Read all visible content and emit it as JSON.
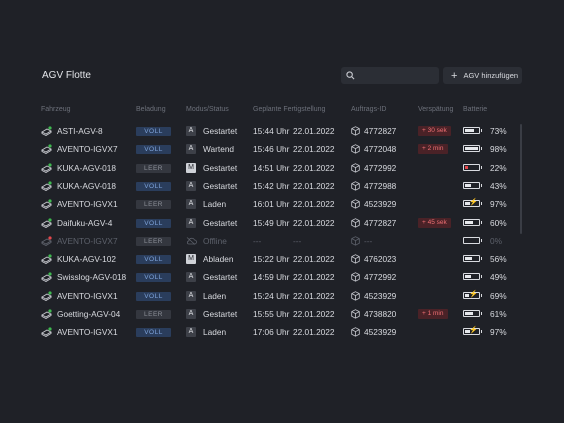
{
  "header": {
    "title": "AGV Flotte",
    "add_button_label": "AGV hinzufügen"
  },
  "search": {
    "placeholder": ""
  },
  "columns": {
    "vehicle": "Fahrzeug",
    "load": "Beladung",
    "mode": "Modus/Status",
    "planned": "Geplante Fertigstellung",
    "order": "Auftrags-ID",
    "delay": "Verspätung",
    "battery": "Batterie"
  },
  "colors": {
    "background": "#1f2127",
    "full_badge": "#2a3d5c",
    "delay_badge": "#4a2227",
    "battery_low": "#e5484d"
  },
  "rows": [
    {
      "vehicle": "ASTI-AGV-8",
      "load": "VOLL",
      "load_state": "full",
      "mode_letter": "A",
      "status": "Gestartet",
      "time": "15:44 Uhr",
      "date": "22.01.2022",
      "order": "4772827",
      "delay": "+ 30 sek",
      "battery_pct": 73,
      "battery_label": "73%",
      "charging": false
    },
    {
      "vehicle": "AVENTO-IGVX7",
      "load": "VOLL",
      "load_state": "full",
      "mode_letter": "A",
      "status": "Wartend",
      "time": "15:46 Uhr",
      "date": "22.01.2022",
      "order": "4772048",
      "delay": "+ 2 min",
      "battery_pct": 98,
      "battery_label": "98%",
      "charging": false
    },
    {
      "vehicle": "KUKA-AGV-018",
      "load": "LEER",
      "load_state": "empty",
      "mode_letter": "M",
      "status": "Gestartet",
      "time": "14:51 Uhr",
      "date": "22.01.2022",
      "order": "4772992",
      "delay": "",
      "battery_pct": 22,
      "battery_label": "22%",
      "charging": false
    },
    {
      "vehicle": "KUKA-AGV-018",
      "load": "VOLL",
      "load_state": "full",
      "mode_letter": "A",
      "status": "Gestartet",
      "time": "15:42 Uhr",
      "date": "22.01.2022",
      "order": "4772988",
      "delay": "",
      "battery_pct": 43,
      "battery_label": "43%",
      "charging": false
    },
    {
      "vehicle": "AVENTO-IGVX1",
      "load": "LEER",
      "load_state": "empty",
      "mode_letter": "A",
      "status": "Laden",
      "time": "16:01 Uhr",
      "date": "22.01.2022",
      "order": "4523929",
      "delay": "",
      "battery_pct": 97,
      "battery_label": "97%",
      "charging": true
    },
    {
      "vehicle": "Daifuku-AGV-4",
      "load": "VOLL",
      "load_state": "full",
      "mode_letter": "A",
      "status": "Gestartet",
      "time": "15:49 Uhr",
      "date": "22.01.2022",
      "order": "4772827",
      "delay": "+ 45 sek",
      "battery_pct": 60,
      "battery_label": "60%",
      "charging": false
    },
    {
      "vehicle": "AVENTO-IGVX7",
      "load": "LEER",
      "load_state": "empty",
      "mode_letter": "",
      "status": "Offline",
      "time": "---",
      "date": "---",
      "order": "---",
      "delay": "",
      "battery_pct": 0,
      "battery_label": "0%",
      "charging": false,
      "offline": true
    },
    {
      "vehicle": "KUKA-AGV-102",
      "load": "VOLL",
      "load_state": "full",
      "mode_letter": "M",
      "status": "Abladen",
      "time": "15:22 Uhr",
      "date": "22.01.2022",
      "order": "4762023",
      "delay": "",
      "battery_pct": 56,
      "battery_label": "56%",
      "charging": false
    },
    {
      "vehicle": "Swisslog-AGV-018",
      "load": "VOLL",
      "load_state": "full",
      "mode_letter": "A",
      "status": "Gestartet",
      "time": "14:59 Uhr",
      "date": "22.01.2022",
      "order": "4772992",
      "delay": "",
      "battery_pct": 49,
      "battery_label": "49%",
      "charging": false
    },
    {
      "vehicle": "AVENTO-IGVX1",
      "load": "VOLL",
      "load_state": "full",
      "mode_letter": "A",
      "status": "Laden",
      "time": "15:24 Uhr",
      "date": "22.01.2022",
      "order": "4523929",
      "delay": "",
      "battery_pct": 69,
      "battery_label": "69%",
      "charging": true
    },
    {
      "vehicle": "Goetting-AGV-04",
      "load": "LEER",
      "load_state": "empty",
      "mode_letter": "A",
      "status": "Gestartet",
      "time": "15:55 Uhr",
      "date": "22.01.2022",
      "order": "4738820",
      "delay": "+ 1 min",
      "battery_pct": 61,
      "battery_label": "61%",
      "charging": false
    },
    {
      "vehicle": "AVENTO-IGVX1",
      "load": "VOLL",
      "load_state": "full",
      "mode_letter": "A",
      "status": "Laden",
      "time": "17:06 Uhr",
      "date": "22.01.2022",
      "order": "4523929",
      "delay": "",
      "battery_pct": 97,
      "battery_label": "97%",
      "charging": true
    }
  ]
}
